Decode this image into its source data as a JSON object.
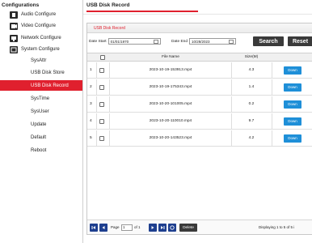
{
  "sidebar": {
    "title": "Configurations",
    "items": [
      {
        "label": "Audio Configure",
        "icon": "audio-icon"
      },
      {
        "label": "Video Configure",
        "icon": "video-icon"
      },
      {
        "label": "Network Configure",
        "icon": "network-icon"
      },
      {
        "label": "System Configure",
        "icon": "system-icon"
      }
    ],
    "sub_items": [
      {
        "label": "SysAttr",
        "active": false
      },
      {
        "label": "USB Disk Store",
        "active": false
      },
      {
        "label": "USB Disk Record",
        "active": true
      },
      {
        "label": "SysTime",
        "active": false
      },
      {
        "label": "SysUser",
        "active": false
      },
      {
        "label": "Update",
        "active": false
      },
      {
        "label": "Default",
        "active": false
      },
      {
        "label": "Reboot",
        "active": false
      }
    ]
  },
  "main": {
    "tab_title": "USB Disk Record",
    "panel_title": "USB Disk Record",
    "filter": {
      "date_start_label": "Date Start",
      "date_start_value": "01/01/1970",
      "date_end_label": "Date End",
      "date_end_value": "10/28/2023",
      "search_label": "Search",
      "reset_label": "Reset"
    },
    "table": {
      "columns": [
        "",
        "File Name",
        "Size(M)",
        ""
      ],
      "rows": [
        {
          "num": "1",
          "file": "2023-10-19-153913.mp4",
          "size": "4.3",
          "action": "Down"
        },
        {
          "num": "2",
          "file": "2023-10-19-175343.mp4",
          "size": "1.4",
          "action": "Down"
        },
        {
          "num": "3",
          "file": "2023-10-20-101005.mp4",
          "size": "0.2",
          "action": "Down"
        },
        {
          "num": "4",
          "file": "2023-10-20-110010.mp4",
          "size": "9.7",
          "action": "Down"
        },
        {
          "num": "5",
          "file": "2023-10-20-143523.mp4",
          "size": "4.2",
          "action": "Down"
        }
      ]
    },
    "pager": {
      "page_label": "Page",
      "page_value": "1",
      "of_label": "of 1",
      "delete_label": "Delete",
      "status": "Displaying 1 to 5 of 5 i"
    }
  },
  "colors": {
    "accent": "#e0202e",
    "download": "#1e8fd8",
    "pager_button": "#1e3f8f",
    "dark_button": "#3a3a3a"
  }
}
